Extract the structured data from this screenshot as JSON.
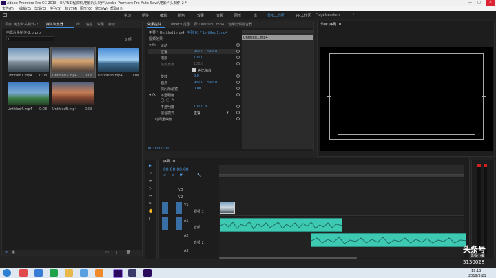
{
  "title_bar": {
    "text": "Adobe Premiere Pro CC 2018 - E:\\PR工程资料\\电影片头制作\\Adobe Premiere Pro Auto-Save\\电影片头制作-2 *"
  },
  "menu": [
    "文件(F)",
    "编辑(E)",
    "剪辑(C)",
    "序列(S)",
    "标记(M)",
    "图形(G)",
    "窗口(W)",
    "帮助(H)"
  ],
  "workspaces": [
    "学习",
    "组件",
    "编辑",
    "颜色",
    "效果",
    "音频",
    "图形",
    "库",
    "显示工作区",
    "PR工作区",
    "Flagelsessions"
  ],
  "project": {
    "tabs": [
      "项目: 电影片头制作-2",
      "媒体浏览器",
      "库",
      "信息",
      "效果",
      "标记"
    ],
    "path": "电影片头制作-2.prproj",
    "count": "5 项",
    "clips": [
      {
        "name": "Untitled1.mp4",
        "dur": "0:08"
      },
      {
        "name": "Untitled2.mp4",
        "dur": "0:08"
      },
      {
        "name": "Untitled3.mp4",
        "dur": "0:08"
      },
      {
        "name": "Untitled4.mp4",
        "dur": "0:08"
      },
      {
        "name": "Untitled5.mp4",
        "dur": "0:08"
      }
    ]
  },
  "effect_controls": {
    "tabs": [
      "效果控件",
      "Lumetri 范围",
      "源: Untitled1.mp4",
      "音频剪辑混合器"
    ],
    "source": "主要 * Untitled1.mp4",
    "sequence": "序列 01 * Untitled1.mp4",
    "section_video": "视频效果",
    "fx_motion": "运动",
    "position": {
      "label": "位置",
      "v1": "960.0",
      "v2": "540.0"
    },
    "scale": {
      "label": "缩放",
      "v": "100.0"
    },
    "scale_width": {
      "label": "缩放宽度",
      "v": "100.0"
    },
    "uniform": "等比缩放",
    "rotation": {
      "label": "旋转",
      "v": "0.0"
    },
    "anchor": {
      "label": "锚点",
      "v1": "960.0",
      "v2": "540.0"
    },
    "flicker": {
      "label": "防闪烁滤镜",
      "v": "0.00"
    },
    "opacity": "不透明度",
    "opacity_value": {
      "label": "不透明度",
      "v": "100.0 %"
    },
    "blend": {
      "label": "混合模式",
      "v": "正常"
    },
    "time_remap": "时间重映射",
    "mini_clip": "Untitled1.mp4",
    "timecode": "00:00:00:00"
  },
  "program": {
    "title": "节目: 序列 01"
  },
  "timeline": {
    "tab": "序列 01",
    "timecode": "00:00:00:00",
    "tracks": [
      "V3",
      "V2",
      "V1",
      "A1",
      "A2",
      "A3"
    ],
    "track_labels": [
      "视频 1",
      "音频 1",
      "音频 2"
    ]
  },
  "taskbar": {
    "time": "19:13",
    "date": "2019/3/21"
  },
  "watermark": {
    "brand": "头条号",
    "sub": "影视小编",
    "id": "5130028"
  }
}
